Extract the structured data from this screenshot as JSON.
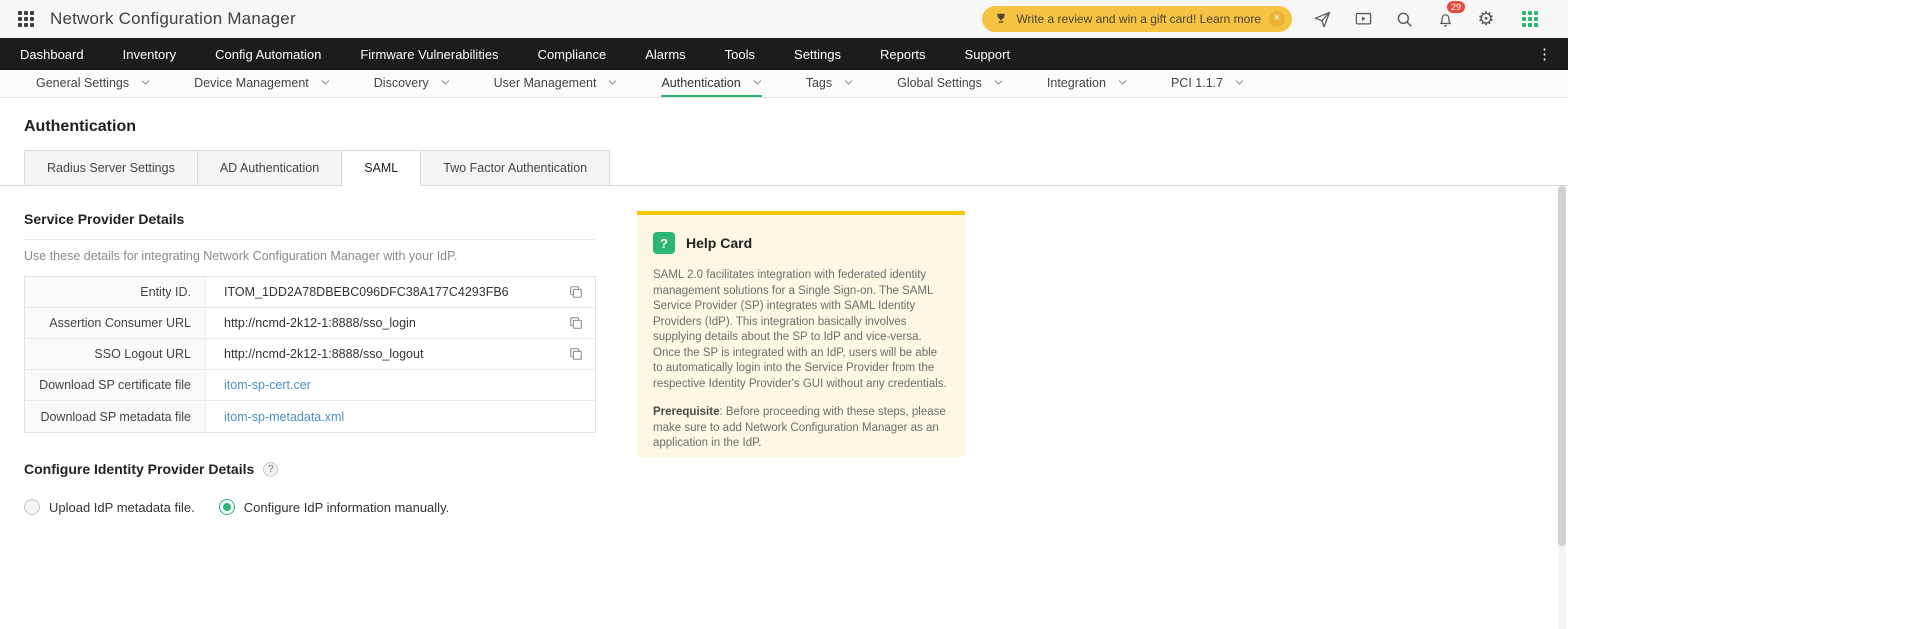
{
  "header": {
    "app_title": "Network Configuration Manager",
    "promo_text": "Write a review and win a gift card! Learn more",
    "notification_count": "29"
  },
  "icons": {
    "gear_glyph": "⚙",
    "more_glyph": "⋮",
    "close_glyph": "×",
    "question_glyph": "?"
  },
  "nav": {
    "items": [
      "Dashboard",
      "Inventory",
      "Config Automation",
      "Firmware Vulnerabilities",
      "Compliance",
      "Alarms",
      "Tools",
      "Settings",
      "Reports",
      "Support"
    ]
  },
  "subnav": {
    "items": [
      {
        "label": "General Settings"
      },
      {
        "label": "Device Management"
      },
      {
        "label": "Discovery"
      },
      {
        "label": "User Management"
      },
      {
        "label": "Authentication",
        "active": true
      },
      {
        "label": "Tags"
      },
      {
        "label": "Global Settings"
      },
      {
        "label": "Integration"
      },
      {
        "label": "PCI 1.1.7"
      }
    ]
  },
  "page": {
    "title": "Authentication"
  },
  "tabs": [
    {
      "label": "Radius Server Settings"
    },
    {
      "label": "AD Authentication"
    },
    {
      "label": "SAML",
      "active": true
    },
    {
      "label": "Two Factor Authentication"
    }
  ],
  "service_provider": {
    "title": "Service Provider Details",
    "description": "Use these details for integrating Network Configuration Manager with your IdP.",
    "rows": [
      {
        "label": "Entity ID.",
        "value": "ITOM_1DD2A78DBEBC096DFC38A177C4293FB6",
        "action": "copy"
      },
      {
        "label": "Assertion Consumer URL",
        "value": "http://ncmd-2k12-1:8888/sso_login",
        "action": "copy"
      },
      {
        "label": "SSO Logout URL",
        "value": "http://ncmd-2k12-1:8888/sso_logout",
        "action": "copy"
      },
      {
        "label": "Download SP certificate file",
        "value": "itom-sp-cert.cer",
        "action": "link"
      },
      {
        "label": "Download SP metadata file",
        "value": "itom-sp-metadata.xml",
        "action": "link"
      }
    ]
  },
  "help_card": {
    "title": "Help Card",
    "body": "SAML 2.0 facilitates integration with federated identity management solutions for a Single Sign-on. The SAML Service Provider (SP) integrates with SAML Identity Providers (IdP). This integration basically involves supplying details about the SP to IdP and vice-versa. Once the SP is integrated with an IdP, users will be able to automatically login into the Service Provider from the respective Identity Provider's GUI without any credentials.",
    "prerequisite_label": "Prerequisite",
    "prerequisite_body": ": Before proceeding with these steps, please make sure to add Network Configuration Manager as an application in the IdP."
  },
  "idp": {
    "title": "Configure Identity Provider Details",
    "options": [
      {
        "label": "Upload IdP metadata file.",
        "selected": false
      },
      {
        "label": "Configure IdP information manually.",
        "selected": true
      }
    ]
  },
  "colors": {
    "accent_green": "#2bb673",
    "promo_yellow": "#f6c343",
    "help_card_bg": "#fdf8e3",
    "help_card_border": "#f2c500",
    "link_blue": "#4a90c2",
    "badge_red": "#e74c3c",
    "nav_dark": "#1c1c1c"
  }
}
